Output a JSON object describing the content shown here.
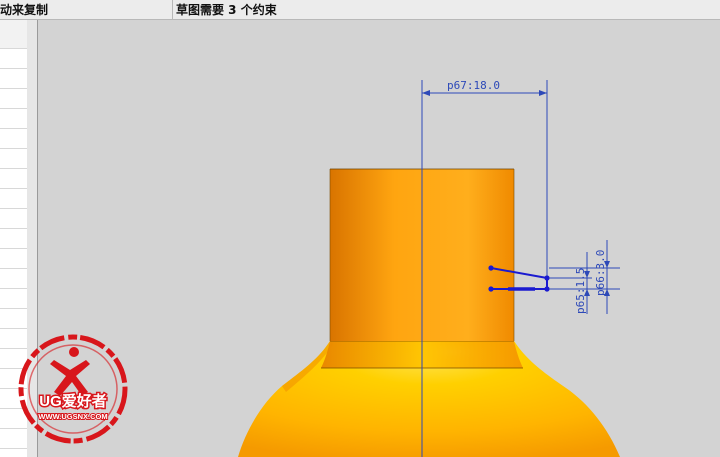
{
  "statusbar": {
    "left_text": "动来复制",
    "message": "草图需要 3 个约束"
  },
  "dimensions": {
    "horizontal": "p67:18.0",
    "vertical_small": "p65:1.5",
    "vertical_large": "p66:3.0"
  },
  "watermark": {
    "brand": "UG爱好者",
    "url": "WWW.UGSNX.COM"
  },
  "colors": {
    "part_orange": "#ff9e00",
    "dimension_blue": "#2d49b8",
    "sketch_blue": "#1a1ad0",
    "watermark_red": "#d8161b",
    "viewport_bg": "#d3d3d3"
  }
}
